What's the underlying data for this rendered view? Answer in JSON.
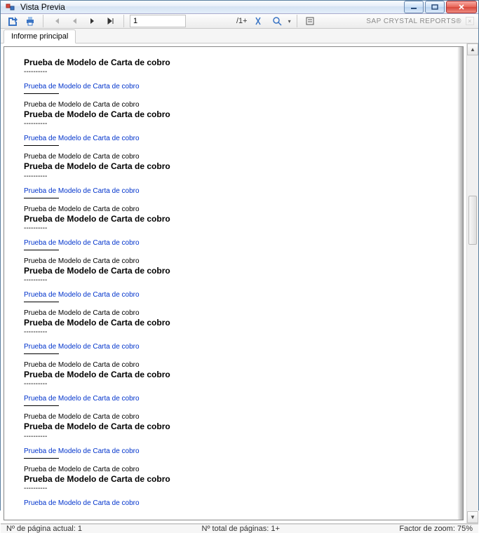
{
  "window": {
    "title": "Vista Previa"
  },
  "toolbar": {
    "page_input_value": "1",
    "page_total": "/1+",
    "brand": "SAP CRYSTAL REPORTS®"
  },
  "tabs": {
    "main": "Informe principal"
  },
  "report": {
    "title": "Prueba de Modelo de Carta de cobro",
    "dots": "----------",
    "link": "Prueba de Modelo de Carta de cobro",
    "small": "Prueba de Modelo de Carta de cobro",
    "bold": "Prueba de Modelo de Carta de cobro"
  },
  "status": {
    "current_page_label": "Nº de página actual:",
    "current_page_value": "1",
    "total_pages_label": "Nº total de páginas:",
    "total_pages_value": "1+",
    "zoom_label": "Factor de zoom:",
    "zoom_value": "75%"
  }
}
